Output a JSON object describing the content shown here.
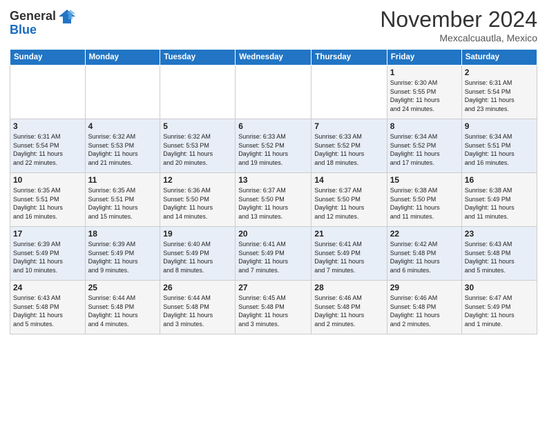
{
  "header": {
    "logo_line1": "General",
    "logo_line2": "Blue",
    "month": "November 2024",
    "location": "Mexcalcuautla, Mexico"
  },
  "weekdays": [
    "Sunday",
    "Monday",
    "Tuesday",
    "Wednesday",
    "Thursday",
    "Friday",
    "Saturday"
  ],
  "weeks": [
    [
      {
        "day": "",
        "info": ""
      },
      {
        "day": "",
        "info": ""
      },
      {
        "day": "",
        "info": ""
      },
      {
        "day": "",
        "info": ""
      },
      {
        "day": "",
        "info": ""
      },
      {
        "day": "1",
        "info": "Sunrise: 6:30 AM\nSunset: 5:55 PM\nDaylight: 11 hours\nand 24 minutes."
      },
      {
        "day": "2",
        "info": "Sunrise: 6:31 AM\nSunset: 5:54 PM\nDaylight: 11 hours\nand 23 minutes."
      }
    ],
    [
      {
        "day": "3",
        "info": "Sunrise: 6:31 AM\nSunset: 5:54 PM\nDaylight: 11 hours\nand 22 minutes."
      },
      {
        "day": "4",
        "info": "Sunrise: 6:32 AM\nSunset: 5:53 PM\nDaylight: 11 hours\nand 21 minutes."
      },
      {
        "day": "5",
        "info": "Sunrise: 6:32 AM\nSunset: 5:53 PM\nDaylight: 11 hours\nand 20 minutes."
      },
      {
        "day": "6",
        "info": "Sunrise: 6:33 AM\nSunset: 5:52 PM\nDaylight: 11 hours\nand 19 minutes."
      },
      {
        "day": "7",
        "info": "Sunrise: 6:33 AM\nSunset: 5:52 PM\nDaylight: 11 hours\nand 18 minutes."
      },
      {
        "day": "8",
        "info": "Sunrise: 6:34 AM\nSunset: 5:52 PM\nDaylight: 11 hours\nand 17 minutes."
      },
      {
        "day": "9",
        "info": "Sunrise: 6:34 AM\nSunset: 5:51 PM\nDaylight: 11 hours\nand 16 minutes."
      }
    ],
    [
      {
        "day": "10",
        "info": "Sunrise: 6:35 AM\nSunset: 5:51 PM\nDaylight: 11 hours\nand 16 minutes."
      },
      {
        "day": "11",
        "info": "Sunrise: 6:35 AM\nSunset: 5:51 PM\nDaylight: 11 hours\nand 15 minutes."
      },
      {
        "day": "12",
        "info": "Sunrise: 6:36 AM\nSunset: 5:50 PM\nDaylight: 11 hours\nand 14 minutes."
      },
      {
        "day": "13",
        "info": "Sunrise: 6:37 AM\nSunset: 5:50 PM\nDaylight: 11 hours\nand 13 minutes."
      },
      {
        "day": "14",
        "info": "Sunrise: 6:37 AM\nSunset: 5:50 PM\nDaylight: 11 hours\nand 12 minutes."
      },
      {
        "day": "15",
        "info": "Sunrise: 6:38 AM\nSunset: 5:50 PM\nDaylight: 11 hours\nand 11 minutes."
      },
      {
        "day": "16",
        "info": "Sunrise: 6:38 AM\nSunset: 5:49 PM\nDaylight: 11 hours\nand 11 minutes."
      }
    ],
    [
      {
        "day": "17",
        "info": "Sunrise: 6:39 AM\nSunset: 5:49 PM\nDaylight: 11 hours\nand 10 minutes."
      },
      {
        "day": "18",
        "info": "Sunrise: 6:39 AM\nSunset: 5:49 PM\nDaylight: 11 hours\nand 9 minutes."
      },
      {
        "day": "19",
        "info": "Sunrise: 6:40 AM\nSunset: 5:49 PM\nDaylight: 11 hours\nand 8 minutes."
      },
      {
        "day": "20",
        "info": "Sunrise: 6:41 AM\nSunset: 5:49 PM\nDaylight: 11 hours\nand 7 minutes."
      },
      {
        "day": "21",
        "info": "Sunrise: 6:41 AM\nSunset: 5:49 PM\nDaylight: 11 hours\nand 7 minutes."
      },
      {
        "day": "22",
        "info": "Sunrise: 6:42 AM\nSunset: 5:48 PM\nDaylight: 11 hours\nand 6 minutes."
      },
      {
        "day": "23",
        "info": "Sunrise: 6:43 AM\nSunset: 5:48 PM\nDaylight: 11 hours\nand 5 minutes."
      }
    ],
    [
      {
        "day": "24",
        "info": "Sunrise: 6:43 AM\nSunset: 5:48 PM\nDaylight: 11 hours\nand 5 minutes."
      },
      {
        "day": "25",
        "info": "Sunrise: 6:44 AM\nSunset: 5:48 PM\nDaylight: 11 hours\nand 4 minutes."
      },
      {
        "day": "26",
        "info": "Sunrise: 6:44 AM\nSunset: 5:48 PM\nDaylight: 11 hours\nand 3 minutes."
      },
      {
        "day": "27",
        "info": "Sunrise: 6:45 AM\nSunset: 5:48 PM\nDaylight: 11 hours\nand 3 minutes."
      },
      {
        "day": "28",
        "info": "Sunrise: 6:46 AM\nSunset: 5:48 PM\nDaylight: 11 hours\nand 2 minutes."
      },
      {
        "day": "29",
        "info": "Sunrise: 6:46 AM\nSunset: 5:48 PM\nDaylight: 11 hours\nand 2 minutes."
      },
      {
        "day": "30",
        "info": "Sunrise: 6:47 AM\nSunset: 5:49 PM\nDaylight: 11 hours\nand 1 minute."
      }
    ]
  ]
}
